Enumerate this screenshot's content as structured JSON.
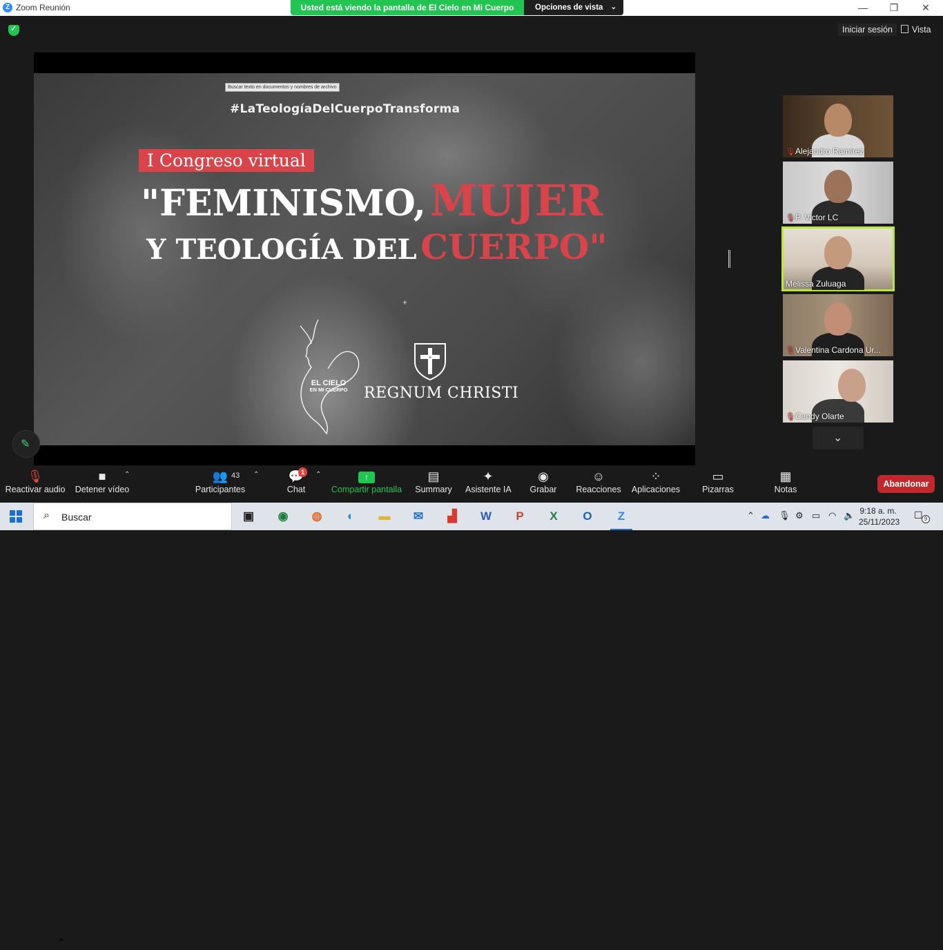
{
  "window": {
    "app_icon": "Z",
    "title": "Zoom Reunión",
    "share_message": "Usted está viendo la pantalla de El Cielo en Mi Cuerpo",
    "view_options": "Opciones de vista",
    "minimize": "—",
    "restore": "❐",
    "close": "✕"
  },
  "top": {
    "sign_in": "Iniciar sesión",
    "view": "Vista"
  },
  "slide": {
    "tooltip": "Buscar texto en documentos y nombres de archivo",
    "hashtag": "#LaTeologíaDelCuerpoTransforma",
    "congreso": "I Congreso virtual",
    "line1_white": "\"FEMINISMO,",
    "line1_red": "MUJER",
    "line2_white": "Y TEOLOGÍA DEL",
    "line2_red": "CUERPO\"",
    "logo1_line1": "EL CIELO",
    "logo1_line2": "EN MI CUERPO",
    "logo2_text": "REGNUM CHRISTI"
  },
  "participants": [
    {
      "name": "Alejandro Ramírez",
      "muted": true,
      "active": false
    },
    {
      "name": "P. Victor LC",
      "muted": true,
      "active": false
    },
    {
      "name": "Melissa Zuluaga",
      "muted": false,
      "active": true
    },
    {
      "name": "Valentina Cardona Ur...",
      "muted": true,
      "active": false
    },
    {
      "name": "Candy Olarte",
      "muted": true,
      "active": false
    }
  ],
  "toolbar": {
    "audio": "Reactivar audio",
    "video": "Detener vídeo",
    "participants": "Participantes",
    "participants_count": "43",
    "chat": "Chat",
    "chat_badge": "1",
    "share": "Compartir pantalla",
    "summary": "Summary",
    "ai": "Asistente IA",
    "record": "Grabar",
    "reactions": "Reacciones",
    "apps": "Aplicaciones",
    "whiteboards": "Pizarras",
    "notes": "Notas",
    "leave": "Abandonar"
  },
  "taskbar": {
    "search": "Buscar",
    "time": "9:18 a. m.",
    "date": "25/11/2023",
    "notifications": "9"
  },
  "colors": {
    "accent_green": "#23c552",
    "brand_red": "#d9434a",
    "leave_red": "#c0282d",
    "active_outline": "#b9e83b"
  }
}
